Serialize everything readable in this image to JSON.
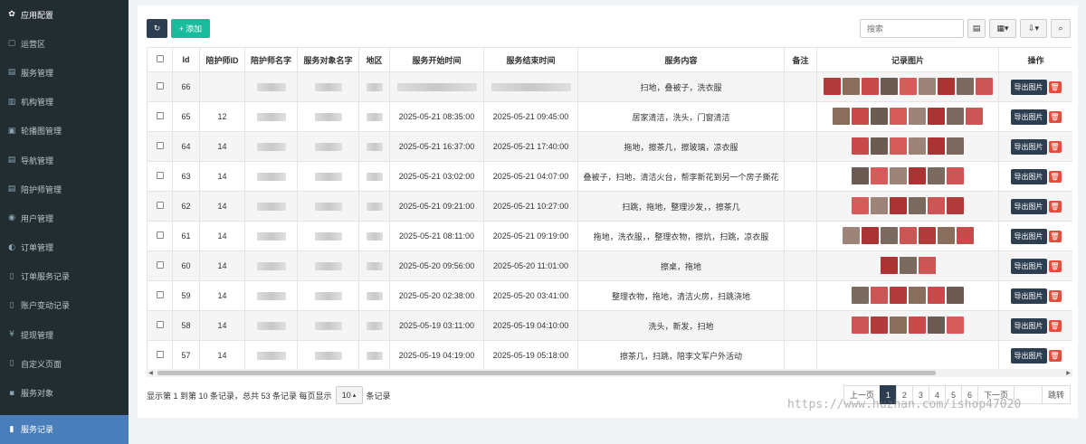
{
  "sidebar": {
    "header": {
      "label": "应用配置",
      "icon": "gear-icon"
    },
    "items": [
      {
        "label": "运营区",
        "icon": "map-icon"
      },
      {
        "label": "服务管理",
        "icon": "list-icon"
      },
      {
        "label": "机构管理",
        "icon": "building-icon"
      },
      {
        "label": "轮播图管理",
        "icon": "image-icon"
      },
      {
        "label": "导航管理",
        "icon": "list-icon"
      },
      {
        "label": "陪护师管理",
        "icon": "list-icon"
      },
      {
        "label": "用户管理",
        "icon": "user-icon"
      },
      {
        "label": "订单管理",
        "icon": "cart-icon"
      },
      {
        "label": "订单服务记录",
        "icon": "file-icon"
      },
      {
        "label": "账户变动记录",
        "icon": "file-icon"
      },
      {
        "label": "提现管理",
        "icon": "yen-icon"
      },
      {
        "label": "自定义页面",
        "icon": "file-icon"
      },
      {
        "label": "服务对象",
        "icon": "id-card-icon"
      }
    ],
    "active": {
      "label": "服务记录",
      "icon": "bookmark-icon"
    }
  },
  "toolbar": {
    "refresh_icon": "↻",
    "add_label": "添加",
    "search_placeholder": "搜索"
  },
  "table": {
    "headers": [
      "Id",
      "陪护师ID",
      "陪护师名字",
      "服务对象名字",
      "地区",
      "服务开始时间",
      "服务结束时间",
      "服务内容",
      "备注",
      "记录图片",
      "操作"
    ],
    "rows": [
      {
        "id": "66",
        "worker_id": "",
        "start": "",
        "end": "",
        "content": "扫地，叠被子，洗衣服",
        "thumbs": 9
      },
      {
        "id": "65",
        "worker_id": "12",
        "start": "2025-05-21 08:35:00",
        "end": "2025-05-21 09:45:00",
        "content": "居家清洁，洗头，门窗清洁",
        "thumbs": 8
      },
      {
        "id": "64",
        "worker_id": "14",
        "start": "2025-05-21 16:37:00",
        "end": "2025-05-21 17:40:00",
        "content": "拖地，擦茶几，擦玻璃，凉衣服",
        "thumbs": 6
      },
      {
        "id": "63",
        "worker_id": "14",
        "start": "2025-05-21 03:02:00",
        "end": "2025-05-21 04:07:00",
        "content": "叠被子，扫地，清洁火台，帮李新花到另一个房子撕花",
        "thumbs": 6
      },
      {
        "id": "62",
        "worker_id": "14",
        "start": "2025-05-21 09:21:00",
        "end": "2025-05-21 10:27:00",
        "content": "扫跳，拖地，整理沙发，，擦茶几",
        "thumbs": 6
      },
      {
        "id": "61",
        "worker_id": "14",
        "start": "2025-05-21 08:11:00",
        "end": "2025-05-21 09:19:00",
        "content": "拖地，洗衣服，，整理衣物，擦炕，扫跳，凉衣服",
        "thumbs": 7
      },
      {
        "id": "60",
        "worker_id": "14",
        "start": "2025-05-20 09:56:00",
        "end": "2025-05-20 11:01:00",
        "content": "擦桌，拖地",
        "thumbs": 3
      },
      {
        "id": "59",
        "worker_id": "14",
        "start": "2025-05-20 02:38:00",
        "end": "2025-05-20 03:41:00",
        "content": "整理衣物，拖地，清洁火房，扫跳浇地",
        "thumbs": 6
      },
      {
        "id": "58",
        "worker_id": "14",
        "start": "2025-05-19 03:11:00",
        "end": "2025-05-19 04:10:00",
        "content": "洗头，新发，扫地",
        "thumbs": 6
      },
      {
        "id": "57",
        "worker_id": "14",
        "start": "2025-05-19 04:19:00",
        "end": "2025-05-19 05:18:00",
        "content": "擦茶几，扫跳，陪李文军户外活动",
        "thumbs": 0
      }
    ],
    "export_label": "导出图片",
    "delete_icon": "trash-icon"
  },
  "pagination": {
    "info_text": "显示第 1 到第 10 条记录，总共 53 条记录 每页显示",
    "page_size": "10",
    "suffix": "条记录",
    "prev": "上一页",
    "pages": [
      "1",
      "2",
      "3",
      "4",
      "5",
      "6"
    ],
    "active_page": "1",
    "next": "下一页",
    "jump": "跳转"
  },
  "watermark": "https://www.huzhan.com/ishop47020",
  "colors": {
    "sidebar_bg": "#222d32",
    "active_item": "#4a7ebb",
    "primary_dark": "#2c3e50",
    "success": "#18bc9c",
    "danger": "#e74c3c"
  }
}
